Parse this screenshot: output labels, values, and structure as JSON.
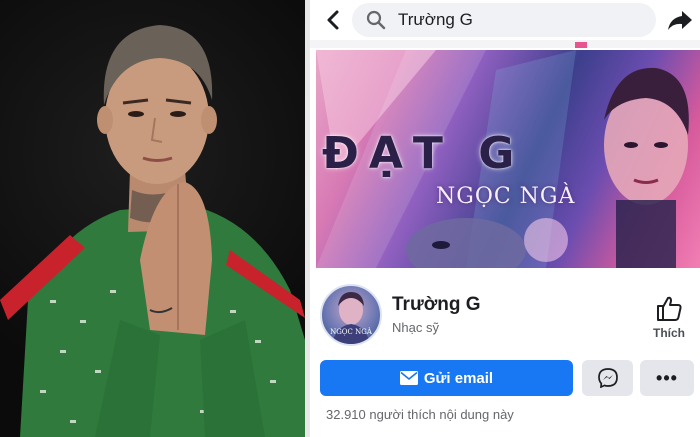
{
  "search": {
    "query": "Trường G"
  },
  "cover": {
    "title": "ĐẠT G",
    "subtitle": "NGỌC NGÀ"
  },
  "profile": {
    "name": "Trường G",
    "category": "Nhạc sỹ",
    "avatar_caption": "NGỌC NGÀ"
  },
  "actions": {
    "like_label": "Thích",
    "email_label": "Gửi email",
    "more_label": "•••"
  },
  "stats": {
    "likes_text": "32.910 người thích nội dung này"
  },
  "colors": {
    "accent": "#1877f2",
    "button_gray": "#e4e6eb",
    "text_secondary": "#65676b",
    "cover_pink": "#e8558e"
  },
  "icons": [
    "back-arrow-icon",
    "search-icon",
    "share-icon",
    "thumbs-up-icon",
    "envelope-icon",
    "messenger-icon",
    "more-icon"
  ]
}
